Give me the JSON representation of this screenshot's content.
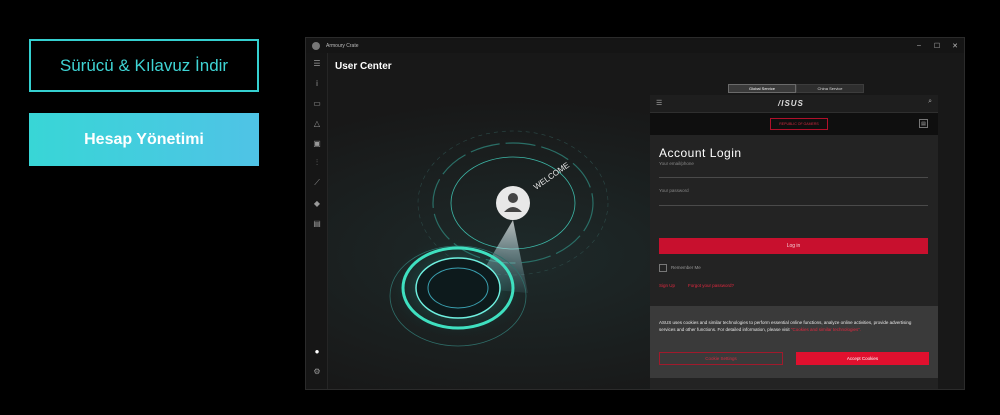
{
  "left_buttons": {
    "download": "Sürücü & Kılavuz İndir",
    "account": "Hesap Yönetimi"
  },
  "window": {
    "app_title": "Armoury Crate",
    "controls": {
      "minimize": "–",
      "maximize": "☐",
      "close": "✕"
    }
  },
  "page_title": "User Center",
  "service_tabs": [
    "Global Service",
    "China Service"
  ],
  "panel": {
    "brand": "/ISUS",
    "rog_logo": "REPUBLIC OF GAMERS",
    "title": "Account Login",
    "email_label": "Your email/phone",
    "password_label": "Your password",
    "login_button": "Log in",
    "remember": "Remember Me",
    "sign_up": "Sign Up",
    "forgot": "Forgot your password?"
  },
  "cookie": {
    "text": "ASUS uses cookies and similar technologies to perform essential online functions, analyze online activities, provide advertising services and other functions. For detailed information, please visit",
    "link": "\"Cookies and similar technologies\".",
    "settings_button": "Cookie Settings",
    "accept_button": "Accept Cookies"
  },
  "art": {
    "welcome": "WELCOME"
  },
  "colors": {
    "accent_cyan": "#35d0d0",
    "rog_red": "#c8102e"
  }
}
